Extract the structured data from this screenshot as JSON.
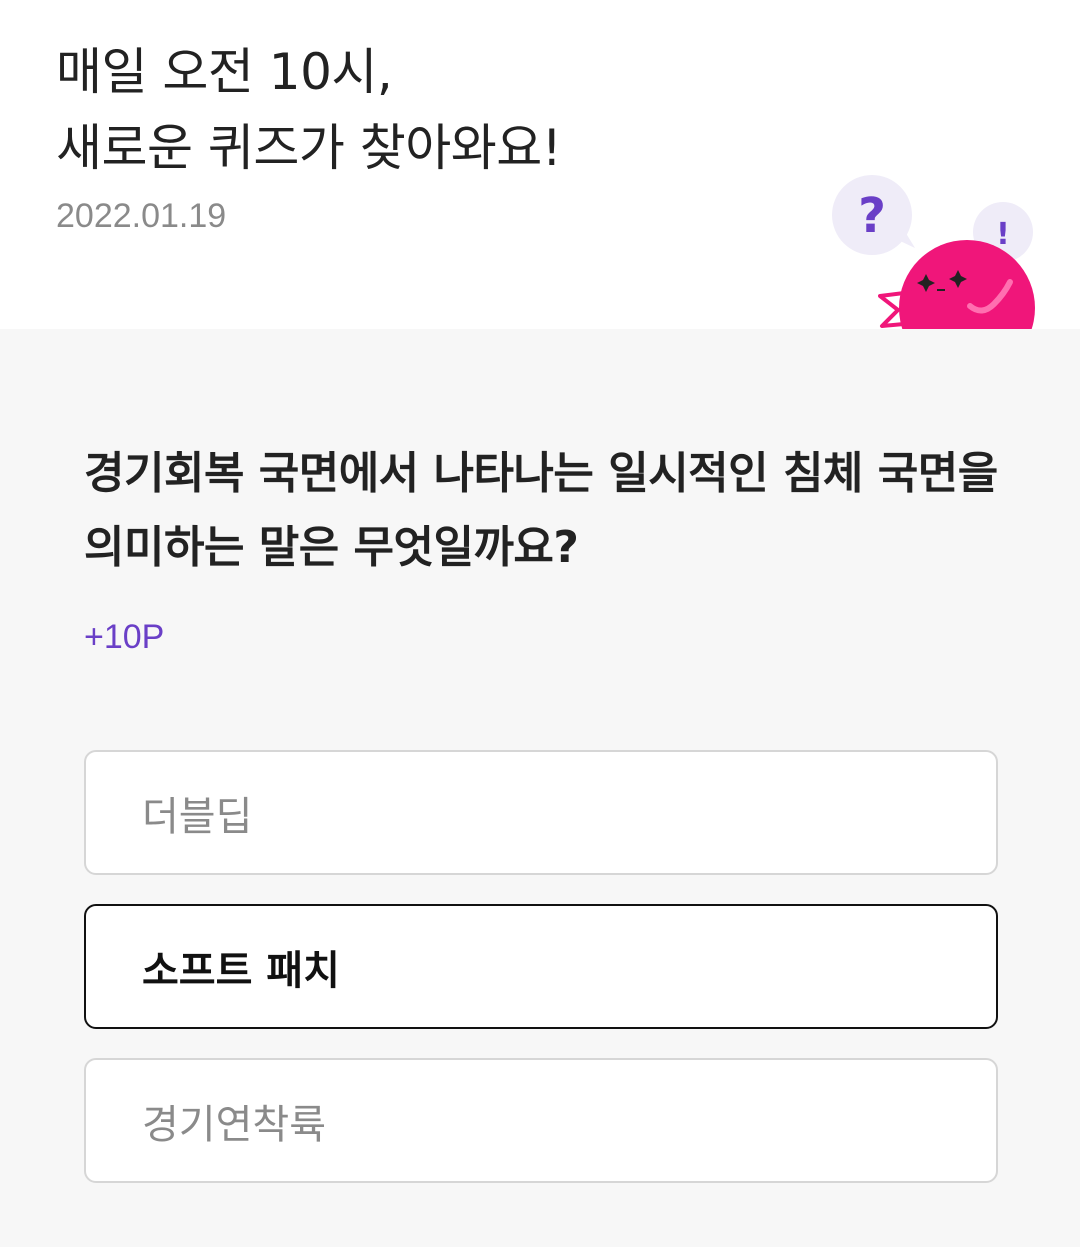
{
  "header": {
    "title_line1": "매일 오전 10시,",
    "title_line2": "새로운 퀴즈가 찾아와요!",
    "date": "2022.01.19"
  },
  "mascot": {
    "bubble_question": "?",
    "bubble_exclaim": "!",
    "body_color": "#f0167a",
    "accent_color": "#6a3fc7"
  },
  "quiz": {
    "question": "경기회복 국면에서 나타나는 일시적인 침체 국면을 의미하는 말은 무엇일까요?",
    "points": "+10P",
    "options": [
      {
        "label": "더블딥",
        "selected": false
      },
      {
        "label": "소프트 패치",
        "selected": true
      },
      {
        "label": "경기연착륙",
        "selected": false
      }
    ]
  }
}
